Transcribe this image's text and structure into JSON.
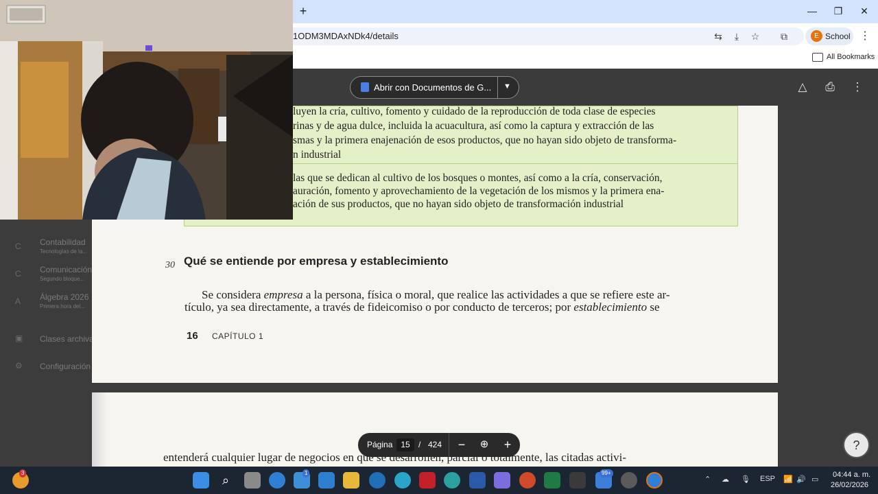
{
  "browser": {
    "url": "1ODM3MDAxNDk4/details",
    "profile_initial": "E",
    "profile_name": "School",
    "bookmarks_label": "All Bookmarks",
    "new_tab": "+",
    "minimize": "—",
    "restore": "❐",
    "close": "✕"
  },
  "pdf": {
    "open_with": "Abrir con Documentos de G...",
    "page_label": "Página",
    "current_page": "15",
    "page_separator": "/",
    "total_pages": "424",
    "zoom_out": "−",
    "zoom_in": "+",
    "help": "?"
  },
  "sidebar": {
    "items": [
      {
        "label": "Contabilidad",
        "sub": "Tecnologías de la..."
      },
      {
        "label": "Comunicación",
        "sub": "Segundo bloque..."
      },
      {
        "label": "Álgebra 2026",
        "sub": "Primera hora del..."
      },
      {
        "label": "Clases archivadas",
        "sub": ""
      },
      {
        "label": "Configuración",
        "sub": ""
      }
    ]
  },
  "document": {
    "green_lines_1": [
      "luyen la cría, cultivo, fomento y cuidado de la reproducción de toda clase de especies",
      "rinas y de agua dulce, incluida la acuacultura, así como la captura y extracción de las",
      "smas y la primera enajenación de esos productos, que no hayan sido objeto de transforma-",
      "n industrial"
    ],
    "green_lines_2": [
      "las que se dedican al cultivo de los bosques o montes, así como a la cría, conservación,",
      "auración, fomento y aprovechamiento de la vegetación de los mismos y la primera ena-",
      "ación de sus productos, que no hayan sido objeto de transformación industrial"
    ],
    "heading_number": "30",
    "heading": "Qué se entiende por empresa y establecimiento",
    "body_line_1_a": "Se considera ",
    "body_line_1_em": "empresa",
    "body_line_1_b": " a la persona, física o moral, que realice las actividades a que se refiere este ar-",
    "body_line_2_a": "tículo, ya sea directamente, a través de fideicomiso o por conducto de terceros; por ",
    "body_line_2_em": "establecimiento",
    "body_line_2_b": " se",
    "page_number": "16",
    "chapter": "CAPÍTULO 1",
    "next_page_line": "entenderá cualquier lugar de negocios en que se desarrollen, parcial o totalmente, las citadas activi-"
  },
  "taskbar": {
    "notif_count": "3",
    "mail_badge": "1",
    "teams_badge": "99+",
    "lang": "ESP",
    "time": "04:44 a. m.",
    "date": "26/02/2026"
  },
  "colors": {
    "tabbar": "#d3e3fd",
    "viewer_bg": "#3c3c3c",
    "highlight_green": "#e4f0c8",
    "profile_orange": "#e8710a",
    "taskbar": "#1c2632"
  }
}
